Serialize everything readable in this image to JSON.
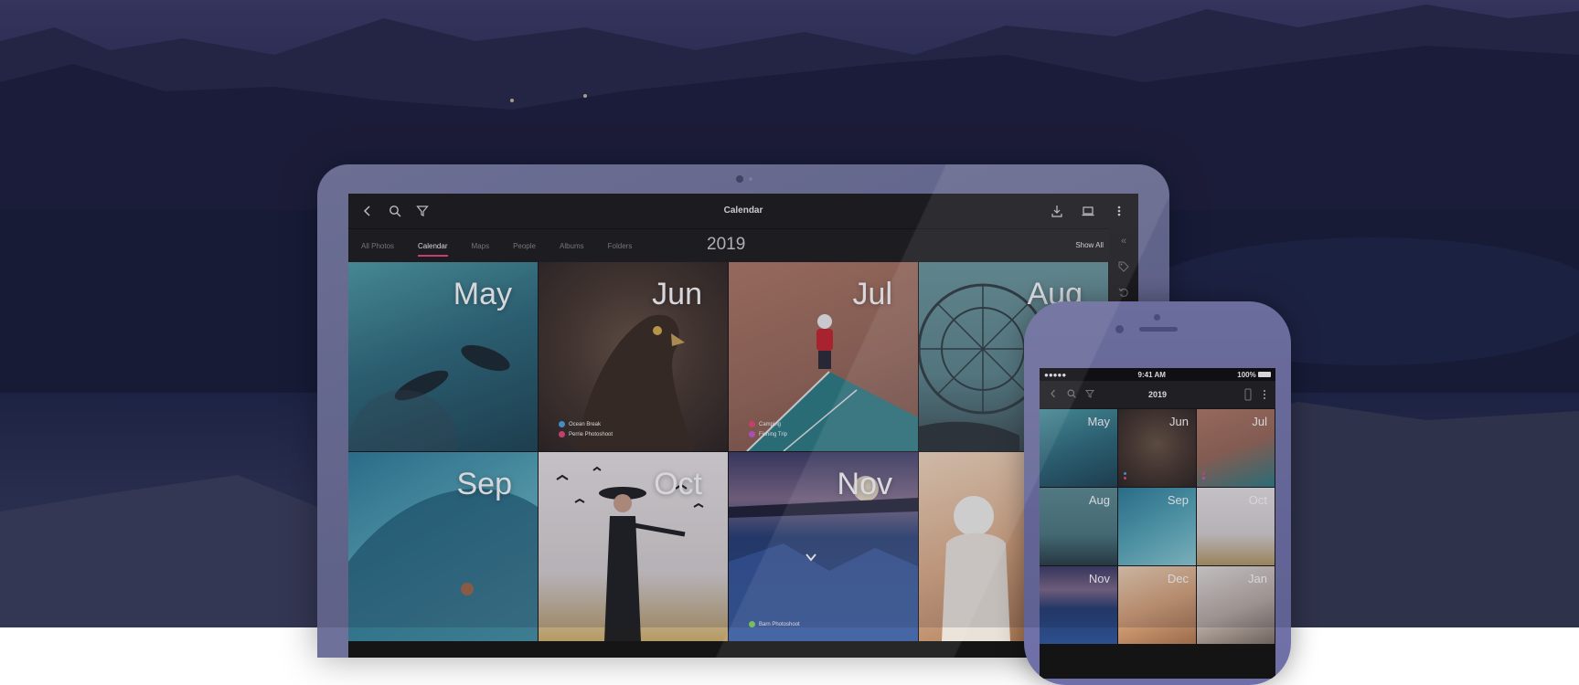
{
  "laptop": {
    "title": "Calendar",
    "tabs": [
      {
        "label": "All Photos",
        "active": false
      },
      {
        "label": "Calendar",
        "active": true
      },
      {
        "label": "Maps",
        "active": false
      },
      {
        "label": "People",
        "active": false
      },
      {
        "label": "Albums",
        "active": false
      },
      {
        "label": "Folders",
        "active": false
      }
    ],
    "year": "2019",
    "show_all": "Show All",
    "months": [
      {
        "label": "May",
        "tags": []
      },
      {
        "label": "Jun",
        "tags": [
          {
            "name": "Ocean Break",
            "color": "#4aa7e8"
          },
          {
            "name": "Perrie Photoshoot",
            "color": "#e8497a"
          }
        ]
      },
      {
        "label": "Jul",
        "tags": [
          {
            "name": "Camping",
            "color": "#e8497a"
          },
          {
            "name": "Fishing Trip",
            "color": "#c85ad6"
          }
        ]
      },
      {
        "label": "Aug",
        "tags": []
      },
      {
        "label": "Sep",
        "tags": []
      },
      {
        "label": "Oct",
        "tags": []
      },
      {
        "label": "Nov",
        "tags": [
          {
            "name": "Barn Photoshoot",
            "color": "#7ed957"
          }
        ]
      },
      {
        "label": "",
        "tags": []
      }
    ],
    "icons": {
      "back": "chevron-left-icon",
      "search": "search-icon",
      "filter": "filter-icon",
      "import": "import-icon",
      "device": "laptop-icon",
      "more": "more-vertical-icon"
    }
  },
  "phone": {
    "status": {
      "carrier": "●●●●● ",
      "time": "9:41 AM",
      "battery": "100%"
    },
    "title": "2019",
    "months": [
      {
        "label": "May"
      },
      {
        "label": "Jun"
      },
      {
        "label": "Jul"
      },
      {
        "label": "Aug"
      },
      {
        "label": "Sep"
      },
      {
        "label": "Oct"
      },
      {
        "label": "Nov"
      },
      {
        "label": "Dec"
      },
      {
        "label": "Jan"
      }
    ]
  },
  "colors": {
    "accent": "#e8497a"
  }
}
